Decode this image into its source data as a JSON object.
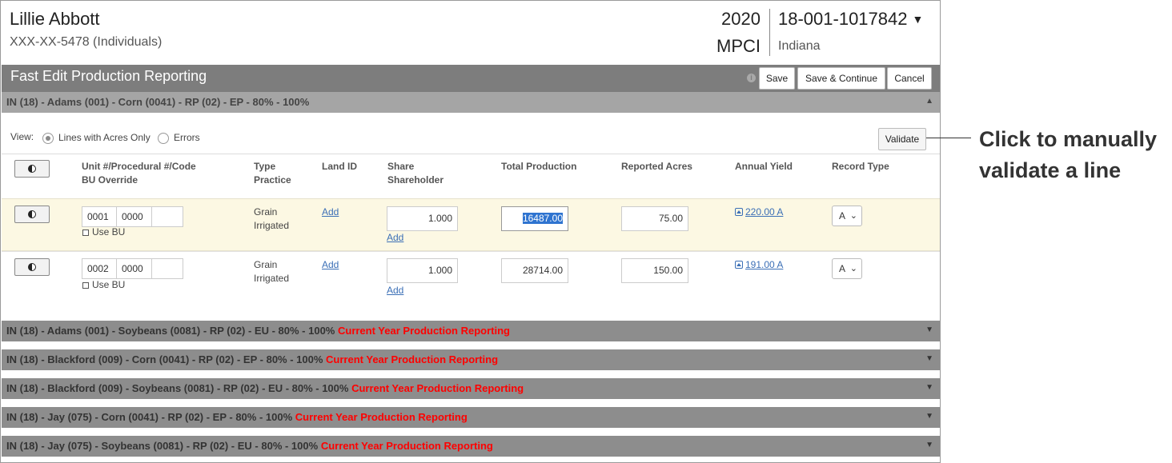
{
  "header": {
    "name": "Lillie Abbott",
    "ssn": "XXX-XX-5478 (Individuals)",
    "year": "2020",
    "program": "MPCI",
    "policy": "18-001-1017842",
    "policy_caret": "▼",
    "state": "Indiana"
  },
  "titlebar": {
    "title": "Fast Edit Production Reporting",
    "info_icon": "i",
    "save": "Save",
    "save_continue": "Save & Continue",
    "cancel": "Cancel"
  },
  "open_section": {
    "title": "IN (18) - Adams (001) - Corn (0041) - RP (02) - EP - 80% - 100%",
    "caret": "▲"
  },
  "view": {
    "label": "View:",
    "options": [
      "Lines with Acres Only",
      "Errors"
    ],
    "selected": "Lines with Acres Only",
    "validate": "Validate"
  },
  "columns": {
    "unit": [
      "Unit #/Procedural #/Code",
      "BU Override"
    ],
    "type": [
      "Type",
      "Practice"
    ],
    "land": "Land ID",
    "share": [
      "Share",
      "Shareholder"
    ],
    "total": "Total Production",
    "acres": "Reported Acres",
    "yield": "Annual Yield",
    "record": "Record Type"
  },
  "rows": [
    {
      "unit": "0001",
      "proc": "0000",
      "code": "",
      "use_bu": "Use BU",
      "type": "Grain",
      "practice": "Irrigated",
      "land_link": "Add",
      "share": "1.000",
      "shareholder_link": "Add",
      "total": "16487.00",
      "acres": "75.00",
      "yield": "220.00 A",
      "record": "A"
    },
    {
      "unit": "0002",
      "proc": "0000",
      "code": "",
      "use_bu": "Use BU",
      "type": "Grain",
      "practice": "Irrigated",
      "land_link": "Add",
      "share": "1.000",
      "shareholder_link": "Add",
      "total": "28714.00",
      "acres": "150.00",
      "yield": "191.00 A",
      "record": "A"
    }
  ],
  "sections": [
    {
      "title": "IN (18) - Adams (001) - Soybeans (0081) - RP (02) - EU - 80% - 100%",
      "status": "Current Year Production Reporting",
      "caret": "▼"
    },
    {
      "title": "IN (18) - Blackford (009) - Corn (0041) - RP (02) - EP - 80% - 100%",
      "status": "Current Year Production Reporting",
      "caret": "▼"
    },
    {
      "title": "IN (18) - Blackford (009) - Soybeans (0081) - RP (02) - EU - 80% - 100%",
      "status": "Current Year Production Reporting",
      "caret": "▼"
    },
    {
      "title": "IN (18) - Jay (075) - Corn (0041) - RP (02) - EP - 80% - 100%",
      "status": "Current Year Production Reporting",
      "caret": "▼"
    },
    {
      "title": "IN (18) - Jay (075) - Soybeans (0081) - RP (02) - EU - 80% - 100%",
      "status": "Current Year Production Reporting",
      "caret": "▼"
    }
  ],
  "callout": {
    "line1": "Click to manually",
    "line2": "validate a line"
  },
  "colors": {
    "titlebar": "#7d7d7d",
    "open_section": "#a5a5a5",
    "collapsed_section": "#8d8d8d",
    "highlight_row": "#fcf8e3",
    "status_red": "#ff0000",
    "link": "#3b6fb6"
  }
}
